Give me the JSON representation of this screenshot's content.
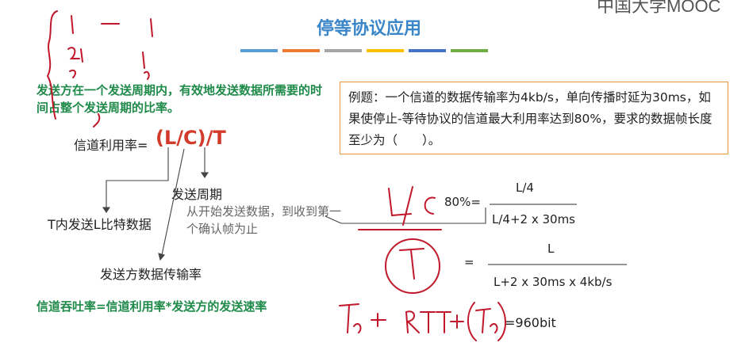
{
  "slide": {
    "title": "停等协议应用",
    "title_bar_colors": [
      "#5b9bd5",
      "#ed7d31",
      "#a5a5a5",
      "#ffc000",
      "#4472c4",
      "#70ad47"
    ],
    "logo_text": "中国大学MOOC",
    "definition": "发送方在一个发送周期内，有效地发送数据所需要的时间占整个发送周期的比率。",
    "utilization_label": "信道利用率=",
    "utilization_formula": "(L/C)/T",
    "label_send_period": "发送周期",
    "label_send_time": "T内发送L比特数据",
    "note_period": "从开始发送数据，到收到第一个确认帧为止",
    "label_rate": "发送方数据传输率",
    "throughput": "信道吞吐率=信道利用率*发送方的发送速率"
  },
  "example": {
    "text": "例题：一个信道的数据传输率为4kb/s，单向传播时延为30ms，如果使停止-等待协议的信道最大利用率达到80%，要求的数据帧长度至少为（　　）。"
  },
  "solution": {
    "pct": "80%=",
    "num1": "L/4",
    "den1": "L/4+2 x 30ms",
    "eq": "=",
    "num2": "L",
    "den2": "L+2 x 30ms x 4kb/s",
    "answer": "=960bit"
  },
  "colors": {
    "accent_green": "#1f8a4a",
    "accent_red": "#d23b2c",
    "title_blue": "#3a86c8",
    "box_border": "#e8963a",
    "ink_red": "#c0182a"
  }
}
